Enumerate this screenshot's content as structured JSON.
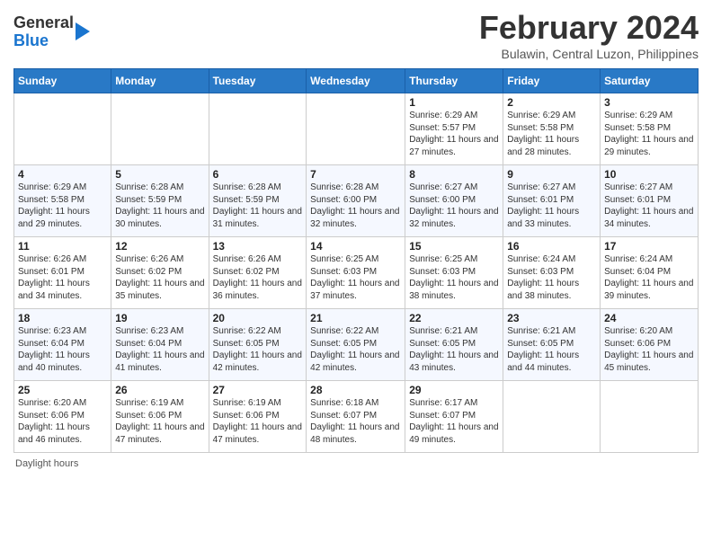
{
  "logo": {
    "line1": "General",
    "line2": "Blue"
  },
  "header": {
    "month": "February 2024",
    "location": "Bulawin, Central Luzon, Philippines"
  },
  "weekdays": [
    "Sunday",
    "Monday",
    "Tuesday",
    "Wednesday",
    "Thursday",
    "Friday",
    "Saturday"
  ],
  "weeks": [
    [
      {
        "day": "",
        "info": ""
      },
      {
        "day": "",
        "info": ""
      },
      {
        "day": "",
        "info": ""
      },
      {
        "day": "",
        "info": ""
      },
      {
        "day": "1",
        "info": "Sunrise: 6:29 AM\nSunset: 5:57 PM\nDaylight: 11 hours and 27 minutes."
      },
      {
        "day": "2",
        "info": "Sunrise: 6:29 AM\nSunset: 5:58 PM\nDaylight: 11 hours and 28 minutes."
      },
      {
        "day": "3",
        "info": "Sunrise: 6:29 AM\nSunset: 5:58 PM\nDaylight: 11 hours and 29 minutes."
      }
    ],
    [
      {
        "day": "4",
        "info": "Sunrise: 6:29 AM\nSunset: 5:58 PM\nDaylight: 11 hours and 29 minutes."
      },
      {
        "day": "5",
        "info": "Sunrise: 6:28 AM\nSunset: 5:59 PM\nDaylight: 11 hours and 30 minutes."
      },
      {
        "day": "6",
        "info": "Sunrise: 6:28 AM\nSunset: 5:59 PM\nDaylight: 11 hours and 31 minutes."
      },
      {
        "day": "7",
        "info": "Sunrise: 6:28 AM\nSunset: 6:00 PM\nDaylight: 11 hours and 32 minutes."
      },
      {
        "day": "8",
        "info": "Sunrise: 6:27 AM\nSunset: 6:00 PM\nDaylight: 11 hours and 32 minutes."
      },
      {
        "day": "9",
        "info": "Sunrise: 6:27 AM\nSunset: 6:01 PM\nDaylight: 11 hours and 33 minutes."
      },
      {
        "day": "10",
        "info": "Sunrise: 6:27 AM\nSunset: 6:01 PM\nDaylight: 11 hours and 34 minutes."
      }
    ],
    [
      {
        "day": "11",
        "info": "Sunrise: 6:26 AM\nSunset: 6:01 PM\nDaylight: 11 hours and 34 minutes."
      },
      {
        "day": "12",
        "info": "Sunrise: 6:26 AM\nSunset: 6:02 PM\nDaylight: 11 hours and 35 minutes."
      },
      {
        "day": "13",
        "info": "Sunrise: 6:26 AM\nSunset: 6:02 PM\nDaylight: 11 hours and 36 minutes."
      },
      {
        "day": "14",
        "info": "Sunrise: 6:25 AM\nSunset: 6:03 PM\nDaylight: 11 hours and 37 minutes."
      },
      {
        "day": "15",
        "info": "Sunrise: 6:25 AM\nSunset: 6:03 PM\nDaylight: 11 hours and 38 minutes."
      },
      {
        "day": "16",
        "info": "Sunrise: 6:24 AM\nSunset: 6:03 PM\nDaylight: 11 hours and 38 minutes."
      },
      {
        "day": "17",
        "info": "Sunrise: 6:24 AM\nSunset: 6:04 PM\nDaylight: 11 hours and 39 minutes."
      }
    ],
    [
      {
        "day": "18",
        "info": "Sunrise: 6:23 AM\nSunset: 6:04 PM\nDaylight: 11 hours and 40 minutes."
      },
      {
        "day": "19",
        "info": "Sunrise: 6:23 AM\nSunset: 6:04 PM\nDaylight: 11 hours and 41 minutes."
      },
      {
        "day": "20",
        "info": "Sunrise: 6:22 AM\nSunset: 6:05 PM\nDaylight: 11 hours and 42 minutes."
      },
      {
        "day": "21",
        "info": "Sunrise: 6:22 AM\nSunset: 6:05 PM\nDaylight: 11 hours and 42 minutes."
      },
      {
        "day": "22",
        "info": "Sunrise: 6:21 AM\nSunset: 6:05 PM\nDaylight: 11 hours and 43 minutes."
      },
      {
        "day": "23",
        "info": "Sunrise: 6:21 AM\nSunset: 6:05 PM\nDaylight: 11 hours and 44 minutes."
      },
      {
        "day": "24",
        "info": "Sunrise: 6:20 AM\nSunset: 6:06 PM\nDaylight: 11 hours and 45 minutes."
      }
    ],
    [
      {
        "day": "25",
        "info": "Sunrise: 6:20 AM\nSunset: 6:06 PM\nDaylight: 11 hours and 46 minutes."
      },
      {
        "day": "26",
        "info": "Sunrise: 6:19 AM\nSunset: 6:06 PM\nDaylight: 11 hours and 47 minutes."
      },
      {
        "day": "27",
        "info": "Sunrise: 6:19 AM\nSunset: 6:06 PM\nDaylight: 11 hours and 47 minutes."
      },
      {
        "day": "28",
        "info": "Sunrise: 6:18 AM\nSunset: 6:07 PM\nDaylight: 11 hours and 48 minutes."
      },
      {
        "day": "29",
        "info": "Sunrise: 6:17 AM\nSunset: 6:07 PM\nDaylight: 11 hours and 49 minutes."
      },
      {
        "day": "",
        "info": ""
      },
      {
        "day": "",
        "info": ""
      }
    ]
  ],
  "footer": "Daylight hours"
}
